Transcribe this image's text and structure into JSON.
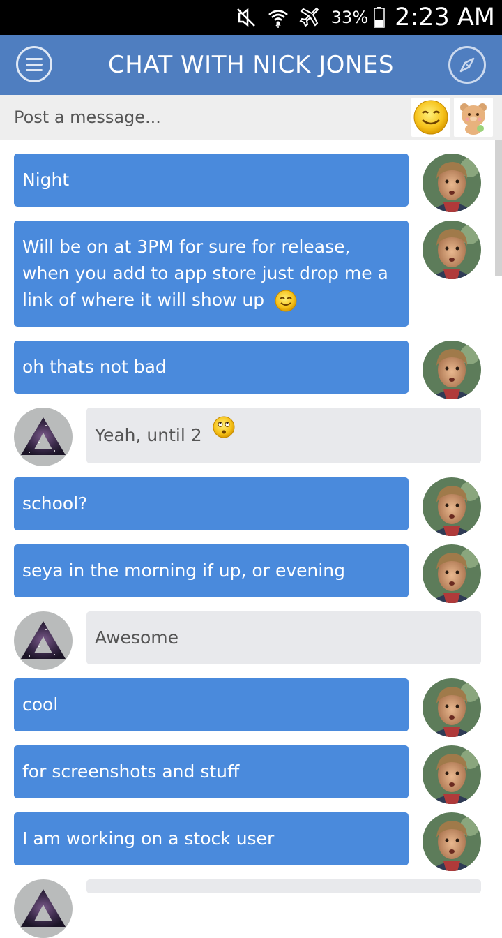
{
  "status_bar": {
    "battery_percent": "33%",
    "time": "2:23 AM",
    "icons": [
      "mute-icon",
      "wifi-icon",
      "airplane-mode-icon",
      "battery-icon"
    ]
  },
  "header": {
    "title": "CHAT WITH NICK JONES",
    "menu_icon": "hamburger-menu-icon",
    "right_icon": "compass-icon",
    "background": "#4f7ec0"
  },
  "composer": {
    "placeholder": "Post a message...",
    "buttons": [
      "smiley-emoji-icon",
      "sticker-bear-icon"
    ]
  },
  "colors": {
    "outgoing_bubble": "#4a8adc",
    "incoming_bubble": "#e8e9ec"
  },
  "messages": [
    {
      "side": "out",
      "text": "Night",
      "avatar": "nick-jones-avatar"
    },
    {
      "side": "out",
      "text": "Will be on at 3PM for sure for release, when you add to app store just drop me a link of where it will show up",
      "emoji": "blushing-smiley-icon",
      "avatar": "nick-jones-avatar"
    },
    {
      "side": "out",
      "text": "oh thats not bad",
      "avatar": "nick-jones-avatar"
    },
    {
      "side": "in",
      "text": "Yeah, until 2",
      "emoji": "rolling-eyes-smiley-icon",
      "avatar": "triangle-galaxy-avatar"
    },
    {
      "side": "out",
      "text": "school?",
      "avatar": "nick-jones-avatar"
    },
    {
      "side": "out",
      "text": "seya in the morning if up, or evening",
      "avatar": "nick-jones-avatar"
    },
    {
      "side": "in",
      "text": "Awesome",
      "avatar": "triangle-galaxy-avatar"
    },
    {
      "side": "out",
      "text": "cool",
      "avatar": "nick-jones-avatar"
    },
    {
      "side": "out",
      "text": "for screenshots and stuff",
      "avatar": "nick-jones-avatar"
    },
    {
      "side": "out",
      "text": "I am working on a stock user",
      "avatar": "nick-jones-avatar"
    },
    {
      "side": "in",
      "text": "",
      "avatar": "triangle-galaxy-avatar"
    }
  ]
}
